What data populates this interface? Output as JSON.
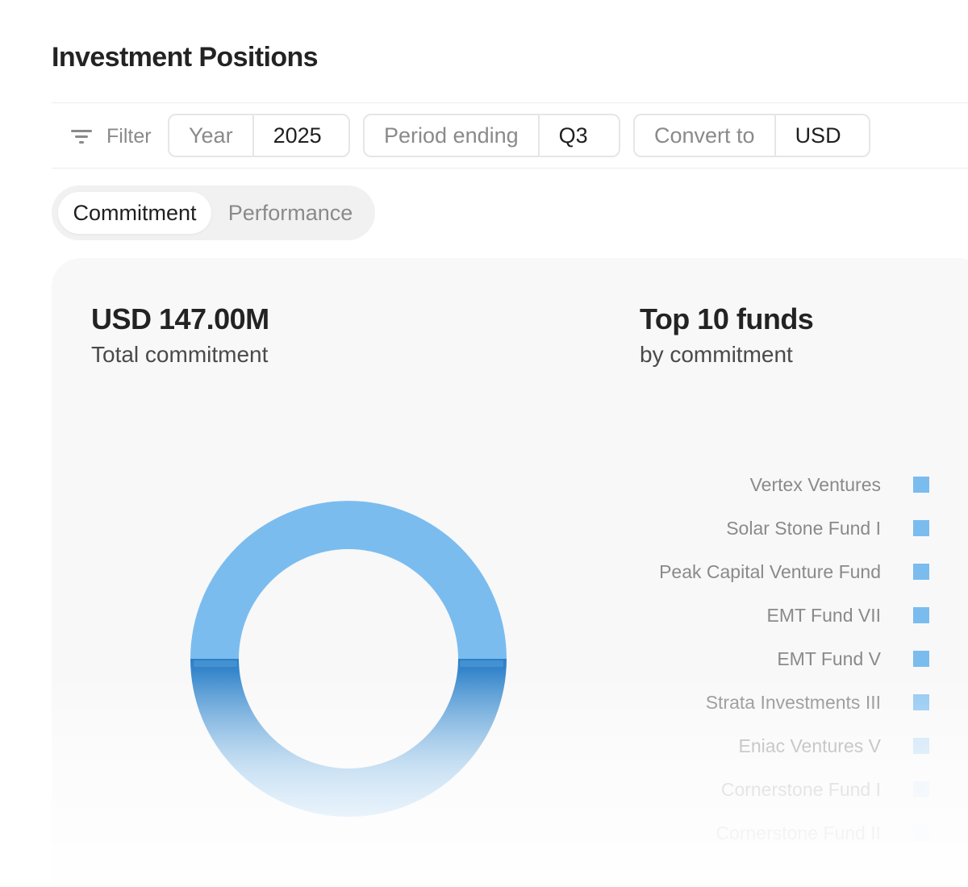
{
  "page": {
    "title": "Investment Positions"
  },
  "filters": {
    "label": "Filter",
    "year": {
      "label": "Year",
      "value": "2025"
    },
    "period": {
      "label": "Period ending",
      "value": "Q3"
    },
    "currency": {
      "label": "Convert to",
      "value": "USD"
    }
  },
  "tabs": [
    {
      "label": "Commitment",
      "active": true
    },
    {
      "label": "Performance",
      "active": false
    }
  ],
  "summary": {
    "total_value": "USD 147.00M",
    "total_caption": "Total commitment",
    "top_title": "Top 10 funds",
    "top_caption": "by commitment"
  },
  "legend": [
    {
      "label": "Vertex Ventures",
      "color": "#7bbcef"
    },
    {
      "label": "Solar Stone Fund I",
      "color": "#7bbcef"
    },
    {
      "label": "Peak Capital Venture Fund",
      "color": "#7bbcef"
    },
    {
      "label": "EMT Fund VII",
      "color": "#7bbcef"
    },
    {
      "label": "EMT Fund V",
      "color": "#7bbcef"
    },
    {
      "label": "Strata Investments III",
      "color": "#8cc5f1"
    },
    {
      "label": "Eniac Ventures V",
      "color": "#b6d9f6"
    },
    {
      "label": "Cornerstone Fund I",
      "color": "#d2e7f9"
    },
    {
      "label": "Cornerstone Fund II",
      "color": "#e0eefa"
    }
  ],
  "colors": {
    "donut_top": "#7bbcef",
    "donut_bottom_start": "#2a7fc8",
    "donut_bottom_end": "#b4d8f2"
  }
}
